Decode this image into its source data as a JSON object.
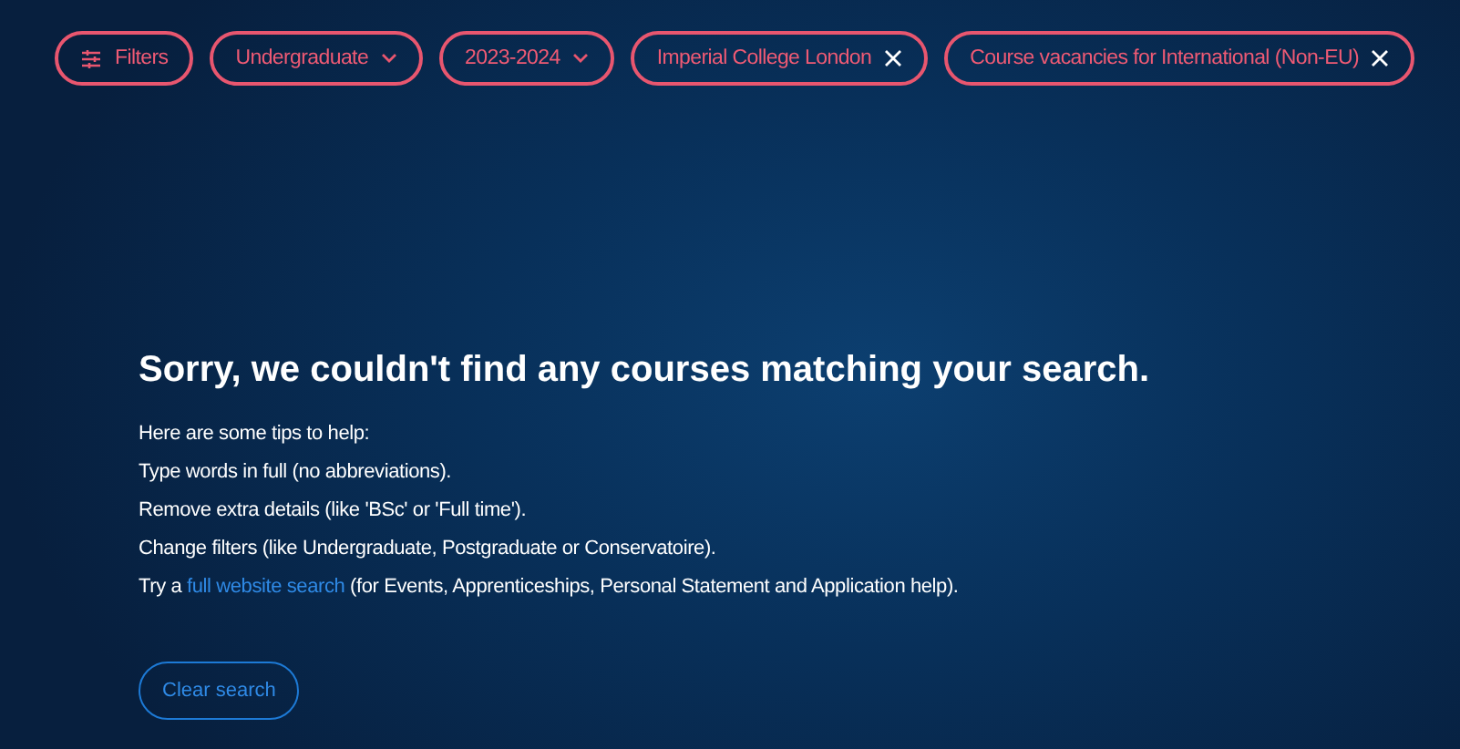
{
  "chips": [
    {
      "kind": "filters",
      "label": "Filters"
    },
    {
      "kind": "dropdown",
      "label": "Undergraduate"
    },
    {
      "kind": "dropdown",
      "label": "2023-2024"
    },
    {
      "kind": "removable",
      "label": "Imperial College London"
    },
    {
      "kind": "removable",
      "label": "Course vacancies for International (Non-EU)"
    }
  ],
  "heading": "Sorry, we couldn't find any courses matching your search.",
  "tips": [
    "Here are some tips to help:",
    "Type words in full (no abbreviations).",
    "Remove extra details (like 'BSc' or 'Full time').",
    "Change filters (like Undergraduate, Postgraduate or Conservatoire)."
  ],
  "search_tip": {
    "before": "Try a ",
    "link": "full website search",
    "after": " (for Events, Apprenticeships, Personal Statement and Application help)."
  },
  "clear_button": "Clear search"
}
